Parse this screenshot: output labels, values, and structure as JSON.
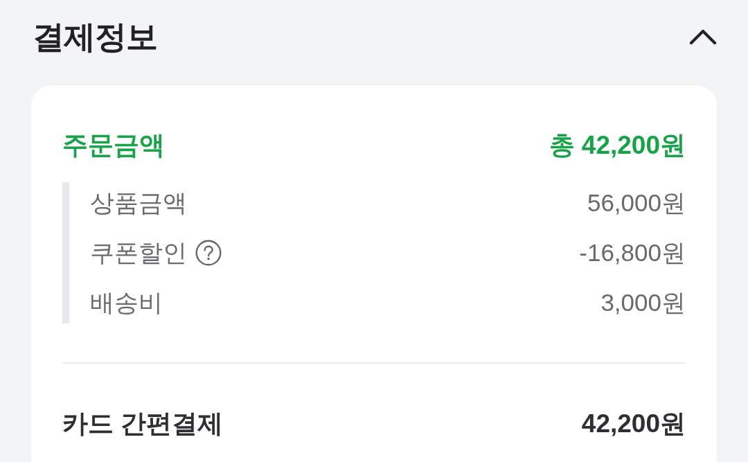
{
  "header": {
    "title": "결제정보",
    "expanded": true
  },
  "order": {
    "label": "주문금액",
    "total": "총 42,200원",
    "items": [
      {
        "label": "상품금액",
        "value": "56,000원",
        "help": false
      },
      {
        "label": "쿠폰할인",
        "value": "-16,800원",
        "help": true
      },
      {
        "label": "배송비",
        "value": "3,000원",
        "help": false
      }
    ]
  },
  "payment": {
    "method": "카드 간편결제",
    "amount": "42,200원"
  }
}
